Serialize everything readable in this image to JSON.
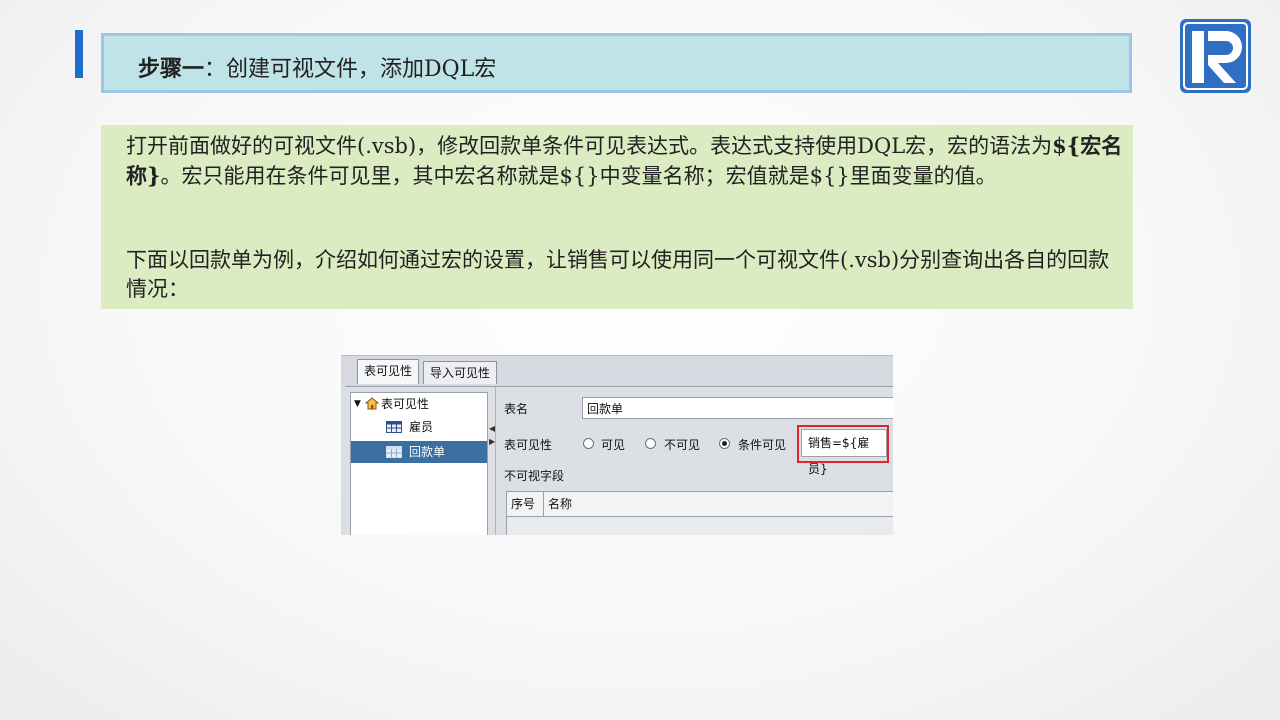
{
  "slide": {
    "title_bold": "步骤一",
    "title_rest": "：创建可视文件，添加DQL宏",
    "accent_color": "#1f6fc8",
    "logo_icon": "raqsoft-r-logo-icon",
    "paragraph1_part1": "打开前面做好的可视文件(.vsb)，修改回款单条件可见表达式。表达式支持使用DQL宏，宏的语法为",
    "paragraph1_bold": "${宏名称}",
    "paragraph1_part2": "。宏只能用在条件可见里，其中宏名称就是${}中变量名称；宏值就是${}里面变量的值。",
    "paragraph2": "下面以回款单为例，介绍如何通过宏的设置，让销售可以使用同一个可视文件(.vsb)分别查询出各自的回款情况："
  },
  "screenshot": {
    "tabs": [
      {
        "label": "表可见性",
        "active": true
      },
      {
        "label": "导入可见性",
        "active": false
      }
    ],
    "tree": {
      "root": "表可见性",
      "items": [
        {
          "label": "雇员",
          "selected": false
        },
        {
          "label": "回款单",
          "selected": true
        }
      ]
    },
    "form": {
      "table_name_label": "表名",
      "table_name_value": "回款单",
      "visibility_label": "表可见性",
      "options": [
        {
          "label": "可见",
          "checked": false
        },
        {
          "label": "不可见",
          "checked": false
        },
        {
          "label": "条件可见",
          "checked": true
        }
      ],
      "condition_value": "销售=${雇员}",
      "invisible_fields_label": "不可视字段",
      "columns": [
        "序号",
        "名称"
      ],
      "highlight_color": "#e0262d"
    }
  }
}
